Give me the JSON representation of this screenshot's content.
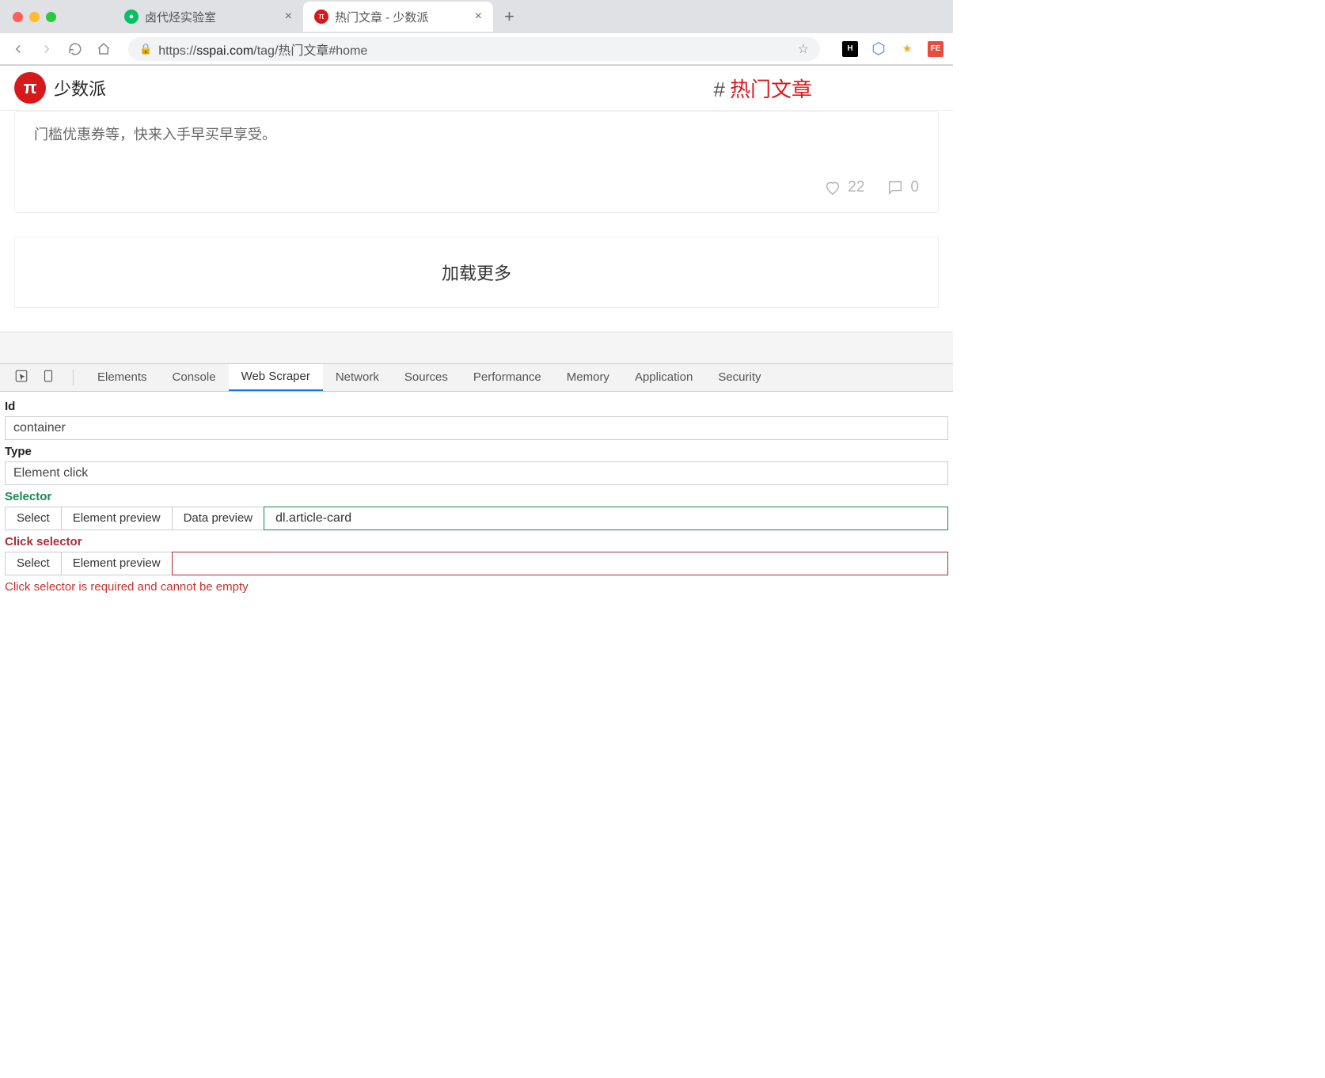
{
  "browser": {
    "tabs": [
      {
        "title": "卤代烃实验室",
        "favicon_color": "#07c160",
        "favicon_glyph": "●",
        "active": false
      },
      {
        "title": "热门文章 - 少数派",
        "favicon_color": "#d7191c",
        "favicon_glyph": "π",
        "active": true
      }
    ],
    "url_prefix": "https://",
    "url_host": "sspai.com",
    "url_path": "/tag/热门文章#home"
  },
  "site": {
    "logo_glyph": "π",
    "logo_text": "少数派",
    "hashtag_label": "热门文章"
  },
  "card": {
    "text_fragment": "门槛优惠券等，快来入手早买早享受。",
    "likes": "22",
    "comments": "0"
  },
  "load_more_label": "加载更多",
  "devtools": {
    "tabs": [
      "Elements",
      "Console",
      "Web Scraper",
      "Network",
      "Sources",
      "Performance",
      "Memory",
      "Application",
      "Security"
    ],
    "active_tab": "Web Scraper",
    "form": {
      "id_label": "Id",
      "id_value": "container",
      "type_label": "Type",
      "type_value": "Element click",
      "selector_label": "Selector",
      "select_btn": "Select",
      "element_preview_btn": "Element preview",
      "data_preview_btn": "Data preview",
      "selector_value": "dl.article-card",
      "click_selector_label": "Click selector",
      "click_selector_value": "",
      "error": "Click selector is required and cannot be empty"
    }
  }
}
